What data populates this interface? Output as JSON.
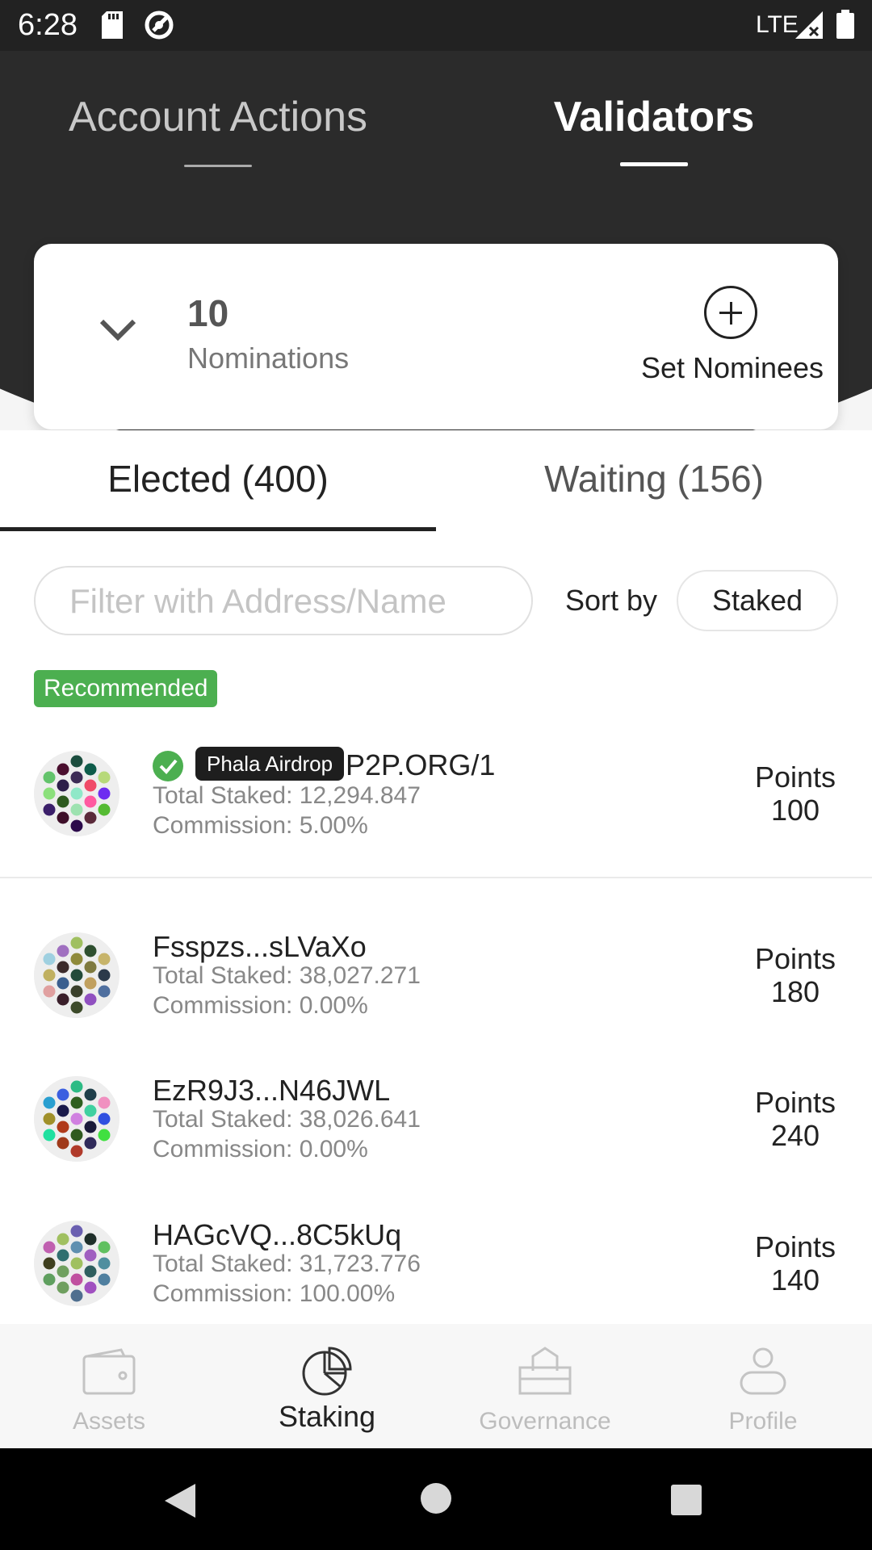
{
  "status_bar": {
    "time": "6:28",
    "network": "LTE"
  },
  "top_tabs": {
    "account_actions": "Account Actions",
    "validators": "Validators"
  },
  "nominations": {
    "count": "10",
    "label": "Nominations",
    "set_nominees": "Set Nominees"
  },
  "sub_tabs": {
    "elected": "Elected (400)",
    "waiting": "Waiting (156)"
  },
  "filter": {
    "placeholder": "Filter with Address/Name",
    "sort_by_label": "Sort by",
    "sort_value": "Staked"
  },
  "recommended_label": "Recommended",
  "validators": [
    {
      "tag": "Phala Airdrop",
      "name": "P2P.ORG/1",
      "verified": true,
      "total_staked": "Total Staked: 12,294.847",
      "commission": "Commission: 5.00%",
      "points_label": "Points",
      "points": "100",
      "avatar_colors": [
        "#1b4d3e",
        "#4a0e2e",
        "#0e5c4a",
        "#3d2b56",
        "#63c36b",
        "#b7d97a",
        "#2d1e4a",
        "#f04a68",
        "#90e8c8",
        "#8be07b",
        "#6e2cf0",
        "#2e5a1f",
        "#ff5aa0",
        "#9de2b0",
        "#3b1f6a",
        "#55bb33",
        "#3e0f2a",
        "#5a2a3a",
        "#2b0a4a",
        "#0e4d5c"
      ]
    },
    {
      "tag": "",
      "name": "Fsspzs...sLVaXo",
      "verified": false,
      "total_staked": "Total Staked: 38,027.271",
      "commission": "Commission: 0.00%",
      "points_label": "Points",
      "points": "180",
      "avatar_colors": [
        "#a0c060",
        "#a070c0",
        "#2e4f2f",
        "#8f8a3a",
        "#9fd0e0",
        "#c7b46a",
        "#3b2a2a",
        "#7f7a3f",
        "#224a3a",
        "#c0b060",
        "#2b3a4a",
        "#3a5f8f",
        "#c1a05f",
        "#3a3f2a",
        "#e0a0a0",
        "#4f6f9f",
        "#3a1f2a",
        "#9050c0",
        "#3c4a2a",
        "#c0b050",
        "#50c070"
      ]
    },
    {
      "tag": "",
      "name": "EzR9J3...N46JWL",
      "verified": false,
      "total_staked": "Total Staked: 38,026.641",
      "commission": "Commission: 0.00%",
      "points_label": "Points",
      "points": "240",
      "avatar_colors": [
        "#2dbb85",
        "#3b5fe0",
        "#1f3f4a",
        "#2f5f1f",
        "#2a9fd0",
        "#f090c0",
        "#1a1a4a",
        "#40d0a0",
        "#d080e0",
        "#a0902a",
        "#3050e0",
        "#b03a1a",
        "#1a1a3a",
        "#2f5a1f",
        "#20e0a0",
        "#40e040",
        "#a03a1a",
        "#302a5a",
        "#b03a2a",
        "#2f5f2a"
      ]
    },
    {
      "tag": "",
      "name": "HAGcVQ...8C5kUq",
      "verified": false,
      "total_staked": "Total Staked: 31,723.776",
      "commission": "Commission: 100.00%",
      "points_label": "Points",
      "points": "140",
      "avatar_colors": [
        "#6a5fb0",
        "#a0c060",
        "#1f2f2a",
        "#5f8fb0",
        "#c060b0",
        "#60c060",
        "#2f6f6f",
        "#a060c0",
        "#a0c060",
        "#3f3f1f",
        "#4f8f9f",
        "#6fa05f",
        "#2f5f5f",
        "#c050a0",
        "#5f9f5f",
        "#4f7f9f",
        "#6f9f5f",
        "#a050c0",
        "#4f6f8f",
        "#b0c060"
      ]
    }
  ],
  "bottom_nav": {
    "assets": "Assets",
    "staking": "Staking",
    "governance": "Governance",
    "profile": "Profile"
  },
  "colors": {
    "dark_header": "#2b2b2b",
    "accent_green": "#4caf50"
  }
}
